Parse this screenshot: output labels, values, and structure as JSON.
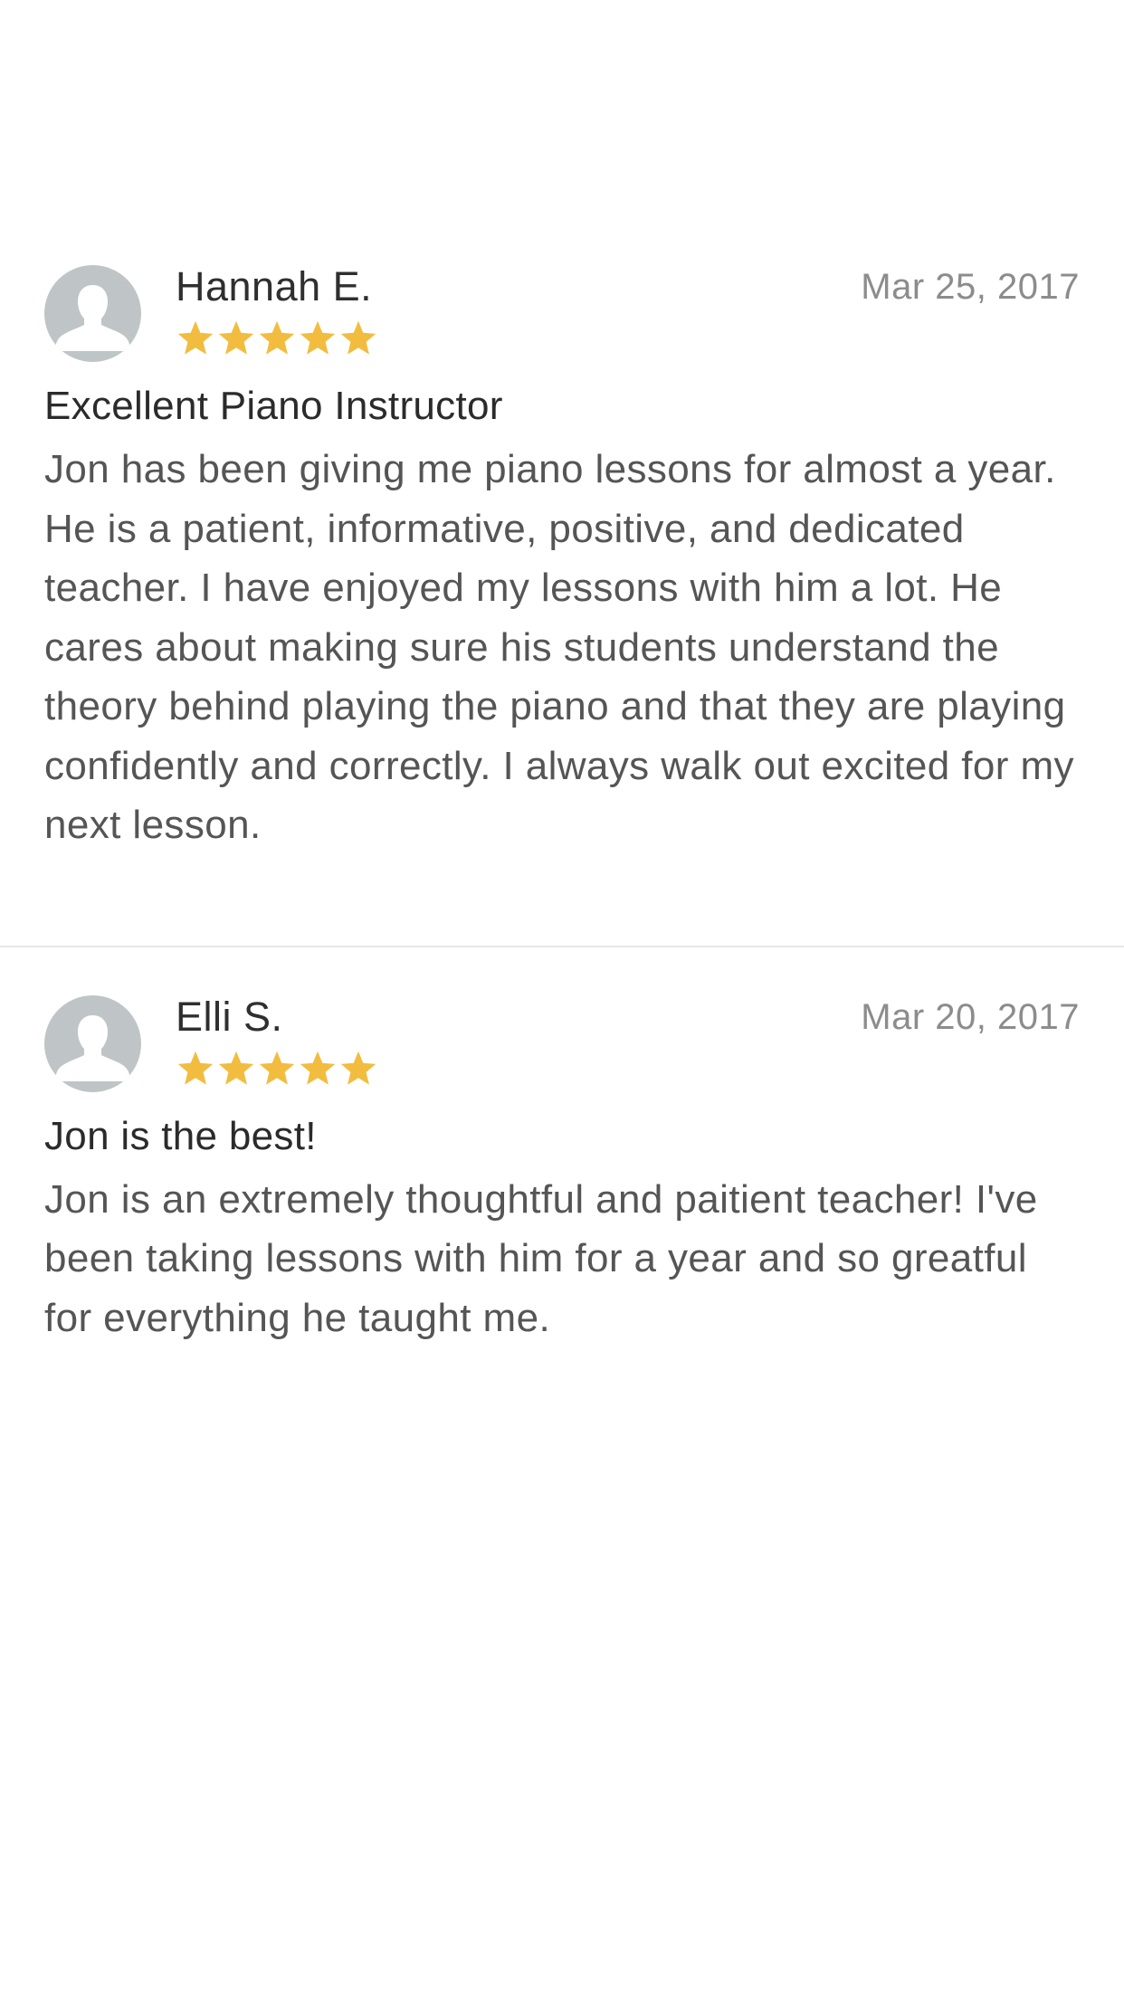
{
  "colors": {
    "star": "#F2BD3F",
    "avatar_bg": "#BFC5C6",
    "date_text": "#8C8C8C",
    "body_text": "#555555",
    "divider": "#E6E6E6"
  },
  "reviews": [
    {
      "name": "Hannah E.",
      "date": "Mar 25, 2017",
      "rating": 5,
      "rating_max": 5,
      "title": "Excellent Piano Instructor",
      "body": "Jon has been giving me piano lessons for almost a year. He is a patient, informative, positive, and dedicated teacher. I have enjoyed my lessons with him a lot. He cares about making sure his students understand the theory behind playing the piano and that they are playing confidently and correctly. I always walk out excited for my next lesson.",
      "avatar_icon": "person-silhouette-icon"
    },
    {
      "name": "Elli S.",
      "date": "Mar 20, 2017",
      "rating": 5,
      "rating_max": 5,
      "title": "Jon is the best!",
      "body": "Jon is an extremely thoughtful and paitient teacher! I've been taking lessons with him for a year and so greatful for everything he taught me.",
      "avatar_icon": "person-silhouette-icon"
    }
  ]
}
